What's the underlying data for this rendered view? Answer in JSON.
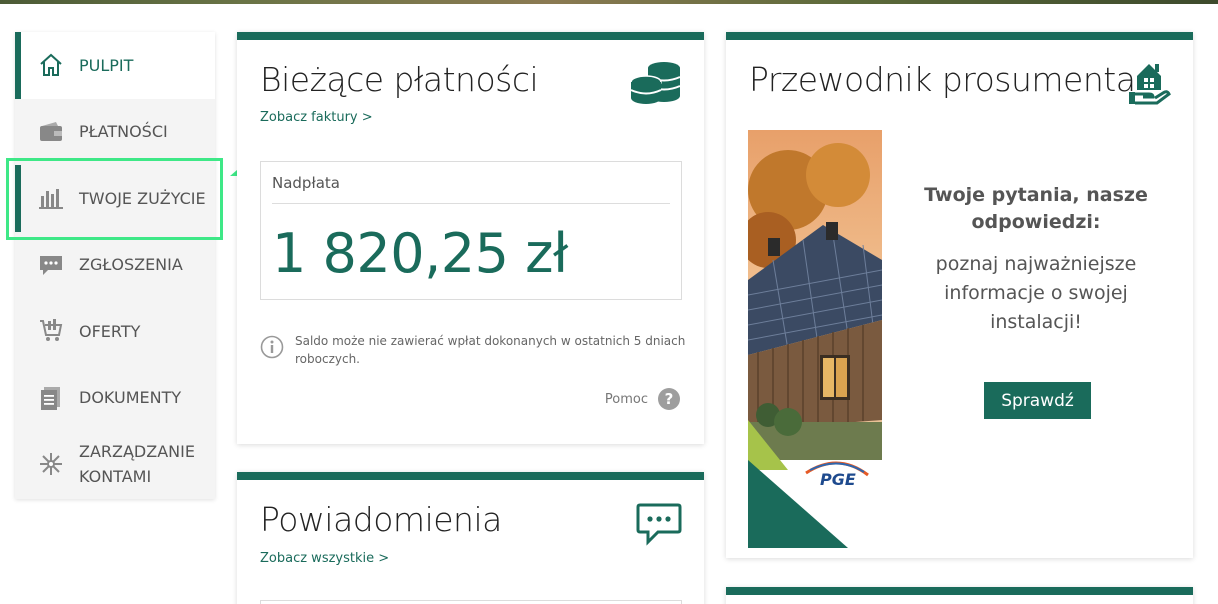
{
  "sidebar": {
    "items": [
      {
        "label": "PULPIT",
        "icon": "home-icon"
      },
      {
        "label": "PŁATNOŚCI",
        "icon": "wallet-icon"
      },
      {
        "label": "TWOJE ZUŻYCIE",
        "icon": "bar-chart-icon"
      },
      {
        "label": "ZGŁOSZENIA",
        "icon": "chat-icon"
      },
      {
        "label": "OFERTY",
        "icon": "cart-icon"
      },
      {
        "label": "DOKUMENTY",
        "icon": "documents-icon"
      },
      {
        "label": "ZARZĄDZANIE KONTAMI",
        "icon": "accounts-icon"
      }
    ]
  },
  "payments": {
    "title": "Bieżące płatności",
    "link": "Zobacz faktury >",
    "balance_label": "Nadpłata",
    "balance_amount": "1 820,25 zł",
    "note": "Saldo może nie zawierać wpłat dokonanych w ostatnich 5 dniach roboczych.",
    "help": "Pomoc",
    "help_glyph": "?"
  },
  "notifications": {
    "title": "Powiadomienia",
    "link": "Zobacz wszystkie >"
  },
  "guide": {
    "title": "Przewodnik prosumenta",
    "heading": "Twoje pytania, nasze odpowiedzi:",
    "body": "poznaj najważniejsze informacje o swojej instalacji!",
    "button": "Sprawdź",
    "logo_text": "PGE"
  },
  "colors": {
    "brand": "#1a6b5b",
    "highlight": "#3ee887"
  }
}
